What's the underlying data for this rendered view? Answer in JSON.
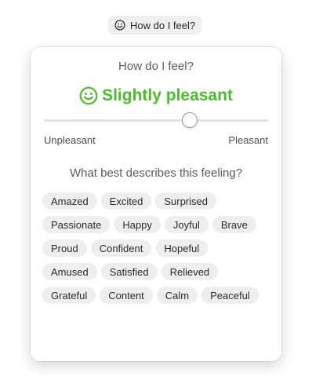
{
  "trigger": {
    "icon": "smiley-icon",
    "label": "How do I feel?"
  },
  "popover": {
    "title": "How do I feel?",
    "mood": {
      "icon": "smiley-icon",
      "label": "Slightly pleasant",
      "color": "#4cbc2a"
    },
    "slider": {
      "value_fraction": 0.65,
      "min_label": "Unpleasant",
      "max_label": "Pleasant"
    },
    "question": "What best describes this feeling?",
    "feeling_rows": [
      [
        "Amazed",
        "Excited",
        "Surprised"
      ],
      [
        "Passionate",
        "Happy",
        "Joyful",
        "Brave"
      ],
      [
        "Proud",
        "Confident",
        "Hopeful"
      ],
      [
        "Amused",
        "Satisfied",
        "Relieved"
      ],
      [
        "Grateful",
        "Content",
        "Calm",
        "Peaceful"
      ]
    ]
  }
}
